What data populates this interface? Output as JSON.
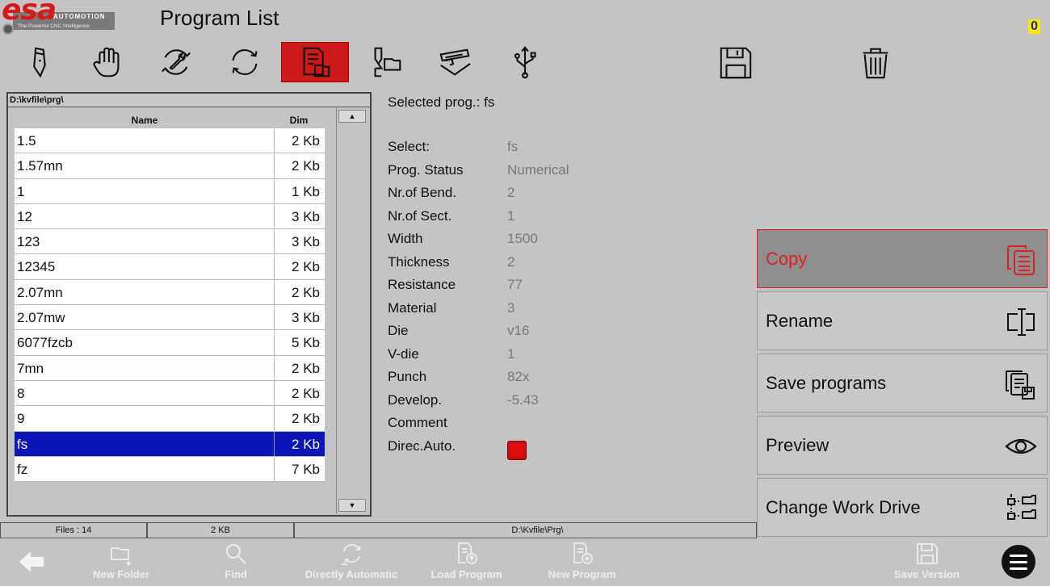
{
  "header": {
    "logo_text": "esa",
    "logo_sub": "AUTOMOTION",
    "logo_tagline": "The Powerful CNC Intelligence",
    "title": "Program List",
    "counter": "0"
  },
  "toolbar": {
    "icons": [
      "pencil-icon",
      "hand-icon",
      "wrench-cycle-icon",
      "refresh-icon",
      "program-list-icon",
      "tooling-icon",
      "press-brake-icon",
      "usb-icon",
      "save-icon",
      "trash-icon"
    ],
    "active": "program-list-icon"
  },
  "filelist": {
    "path": "D:\\kvfile\\prg\\",
    "col_name": "Name",
    "col_dim": "Dim",
    "rows": [
      {
        "name": "1.5",
        "dim": "2 Kb"
      },
      {
        "name": "1.57mn",
        "dim": "2 Kb"
      },
      {
        "name": "1",
        "dim": "1 Kb"
      },
      {
        "name": "12",
        "dim": "3 Kb"
      },
      {
        "name": "123",
        "dim": "3 Kb"
      },
      {
        "name": "12345",
        "dim": "2 Kb"
      },
      {
        "name": "2.07mn",
        "dim": "2 Kb"
      },
      {
        "name": "2.07mw",
        "dim": "3 Kb"
      },
      {
        "name": "6077fzcb",
        "dim": "5 Kb"
      },
      {
        "name": "7mn",
        "dim": "2 Kb"
      },
      {
        "name": "8",
        "dim": "2 Kb"
      },
      {
        "name": "9",
        "dim": "2 Kb"
      },
      {
        "name": "fs",
        "dim": "2 Kb"
      },
      {
        "name": "fz",
        "dim": "7 Kb"
      }
    ],
    "selected_index": 12
  },
  "details": {
    "selected_label": "Selected prog.:",
    "selected_value": "fs",
    "rows": [
      {
        "label": "Select:",
        "value": "fs"
      },
      {
        "label": "Prog. Status",
        "value": "Numerical"
      },
      {
        "label": "Nr.of Bend.",
        "value": "2"
      },
      {
        "label": "Nr.of Sect.",
        "value": "1"
      },
      {
        "label": "Width",
        "value": "1500"
      },
      {
        "label": "Thickness",
        "value": "2"
      },
      {
        "label": "Resistance",
        "value": "77"
      },
      {
        "label": "Material",
        "value": "3"
      },
      {
        "label": "Die",
        "value": "v16"
      },
      {
        "label": "V-die",
        "value": "1"
      },
      {
        "label": "Punch",
        "value": "82x"
      },
      {
        "label": "Develop.",
        "value": "-5.43"
      },
      {
        "label": "Comment",
        "value": ""
      },
      {
        "label": "Direc.Auto.",
        "value": ""
      }
    ],
    "direc_auto_status_color": "#e01010"
  },
  "actions": [
    {
      "label": "Copy",
      "icon": "copy-icon",
      "active": true
    },
    {
      "label": "Rename",
      "icon": "rename-icon",
      "active": false
    },
    {
      "label": "Save programs",
      "icon": "save-programs-icon",
      "active": false
    },
    {
      "label": "Preview",
      "icon": "eye-icon",
      "active": false
    },
    {
      "label": "Change Work Drive",
      "icon": "change-drive-icon",
      "active": false
    }
  ],
  "statusbar": {
    "files": "Files : 14",
    "size": "2 KB",
    "path": "D:\\Kvfile\\Prg\\"
  },
  "bottom": {
    "new_folder": "New Folder",
    "find": "Find",
    "directly_automatic": "Directly Automatic",
    "load_program": "Load Program",
    "new_program": "New Program",
    "save_version": "Save Version"
  },
  "colors": {
    "accent_red": "#cc1a1a",
    "selection_blue": "#0a16b8",
    "background": "#c4c4c4"
  }
}
